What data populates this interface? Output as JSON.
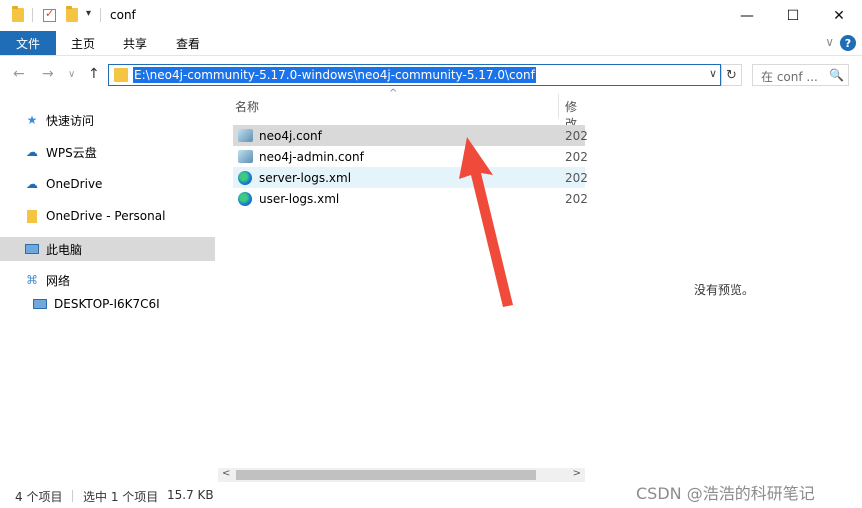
{
  "window": {
    "title": "conf",
    "minimize_icon": "—",
    "maximize_icon": "☐",
    "close_icon": "✕"
  },
  "ribbon": {
    "tabs": [
      {
        "label": "文件"
      },
      {
        "label": "主页"
      },
      {
        "label": "共享"
      },
      {
        "label": "查看"
      }
    ],
    "expand_icon": "∨",
    "help_icon": "?"
  },
  "nav": {
    "back_icon": "←",
    "forward_icon": "→",
    "recent_icon": "∨",
    "up_icon": "↑"
  },
  "address": {
    "path": "E:\\neo4j-community-5.17.0-windows\\neo4j-community-5.17.0\\conf",
    "dropdown_icon": "∨",
    "refresh_icon": "↻"
  },
  "search": {
    "placeholder": "在 conf ...",
    "icon": "🔍"
  },
  "sidebar": {
    "items": [
      {
        "label": "快速访问",
        "icon": "★",
        "color": "#3c8dde"
      },
      {
        "label": "WPS云盘",
        "icon": "☁",
        "color": "#1e6db6"
      },
      {
        "label": "OneDrive",
        "icon": "☁",
        "color": "#1e6db6"
      },
      {
        "label": "OneDrive - Personal",
        "icon": "▮",
        "color": "#f4c542"
      },
      {
        "label": "此电脑",
        "icon": "▭",
        "color": "#4a8ecb"
      },
      {
        "label": "网络",
        "icon": "⌘",
        "color": "#4a8ecb"
      },
      {
        "label": "DESKTOP-I6K7C6I",
        "icon": "▭",
        "color": "#4a8ecb"
      }
    ]
  },
  "columns": {
    "name": "名称",
    "modified": "修改",
    "sort_icon": "^"
  },
  "files": [
    {
      "name": "neo4j.conf",
      "date": "202",
      "type": "conf"
    },
    {
      "name": "neo4j-admin.conf",
      "date": "202",
      "type": "conf"
    },
    {
      "name": "server-logs.xml",
      "date": "202",
      "type": "edge"
    },
    {
      "name": "user-logs.xml",
      "date": "202",
      "type": "edge"
    }
  ],
  "scrollbar": {
    "left_icon": "<",
    "right_icon": ">"
  },
  "preview": {
    "text": "没有预览。"
  },
  "status": {
    "item_count": "4 个项目",
    "selection": "选中 1 个项目",
    "size": "15.7 KB"
  },
  "watermark": "CSDN @浩浩的科研笔记",
  "colors": {
    "accent": "#1e6db6",
    "selection": "#1a73e8",
    "arrow": "#ef4a3a"
  }
}
